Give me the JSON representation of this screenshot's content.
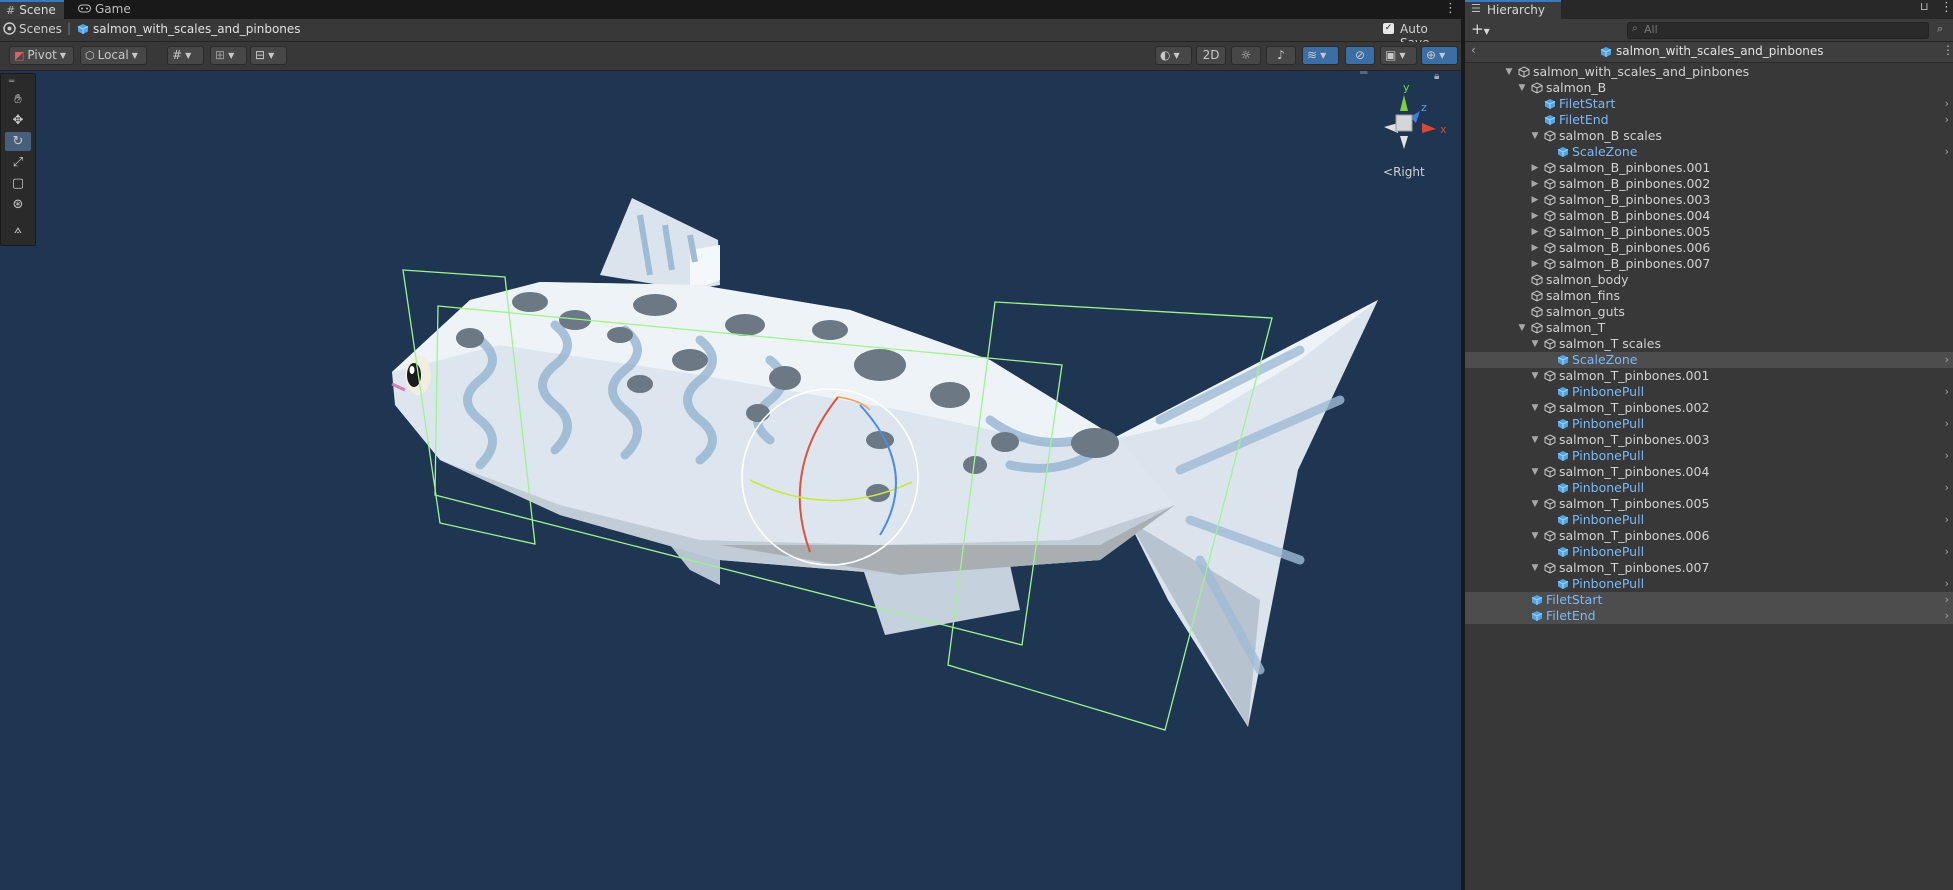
{
  "scene_tabs": [
    {
      "label": "Scene",
      "icon": "grid-icon",
      "active": true
    },
    {
      "label": "Game",
      "icon": "gamepad-icon",
      "active": false
    }
  ],
  "breadcrumb": {
    "root": "Scenes",
    "current": "salmon_with_scales_and_pinbones"
  },
  "auto_save": {
    "label": "Auto Save",
    "checked": true
  },
  "toolbar": {
    "pivot": "Pivot",
    "local": "Local",
    "mode_2d": "2D"
  },
  "gizmo": {
    "view_label": "Right",
    "axis_y": "y",
    "axis_z": "z",
    "axis_x": "x"
  },
  "tools": [
    "hand-tool",
    "move-tool",
    "rotate-tool",
    "scale-tool",
    "rect-tool",
    "transform-tool",
    "custom-tool"
  ],
  "hierarchy": {
    "tab_label": "Hierarchy",
    "search_placeholder": "All",
    "scene_name": "salmon_with_scales_and_pinbones",
    "rows": [
      {
        "label": "salmon_with_scales_and_pinbones",
        "depth": 0,
        "arrow": "open",
        "prefab": false,
        "chevron": false,
        "selected": false
      },
      {
        "label": "salmon_B",
        "depth": 1,
        "arrow": "open",
        "prefab": false,
        "chevron": false,
        "selected": false
      },
      {
        "label": "FiletStart",
        "depth": 2,
        "arrow": "none",
        "prefab": true,
        "chevron": true,
        "selected": false
      },
      {
        "label": "FiletEnd",
        "depth": 2,
        "arrow": "none",
        "prefab": true,
        "chevron": true,
        "selected": false
      },
      {
        "label": "salmon_B scales",
        "depth": 2,
        "arrow": "open",
        "prefab": false,
        "chevron": false,
        "selected": false
      },
      {
        "label": "ScaleZone",
        "depth": 3,
        "arrow": "none",
        "prefab": true,
        "chevron": true,
        "selected": false
      },
      {
        "label": "salmon_B_pinbones.001",
        "depth": 2,
        "arrow": "closed",
        "prefab": false,
        "chevron": false,
        "selected": false
      },
      {
        "label": "salmon_B_pinbones.002",
        "depth": 2,
        "arrow": "closed",
        "prefab": false,
        "chevron": false,
        "selected": false
      },
      {
        "label": "salmon_B_pinbones.003",
        "depth": 2,
        "arrow": "closed",
        "prefab": false,
        "chevron": false,
        "selected": false
      },
      {
        "label": "salmon_B_pinbones.004",
        "depth": 2,
        "arrow": "closed",
        "prefab": false,
        "chevron": false,
        "selected": false
      },
      {
        "label": "salmon_B_pinbones.005",
        "depth": 2,
        "arrow": "closed",
        "prefab": false,
        "chevron": false,
        "selected": false
      },
      {
        "label": "salmon_B_pinbones.006",
        "depth": 2,
        "arrow": "closed",
        "prefab": false,
        "chevron": false,
        "selected": false
      },
      {
        "label": "salmon_B_pinbones.007",
        "depth": 2,
        "arrow": "closed",
        "prefab": false,
        "chevron": false,
        "selected": false
      },
      {
        "label": "salmon_body",
        "depth": 1,
        "arrow": "none",
        "prefab": false,
        "chevron": false,
        "selected": false
      },
      {
        "label": "salmon_fins",
        "depth": 1,
        "arrow": "none",
        "prefab": false,
        "chevron": false,
        "selected": false
      },
      {
        "label": "salmon_guts",
        "depth": 1,
        "arrow": "none",
        "prefab": false,
        "chevron": false,
        "selected": false
      },
      {
        "label": "salmon_T",
        "depth": 1,
        "arrow": "open",
        "prefab": false,
        "chevron": false,
        "selected": false
      },
      {
        "label": "salmon_T scales",
        "depth": 2,
        "arrow": "open",
        "prefab": false,
        "chevron": false,
        "selected": false
      },
      {
        "label": "ScaleZone",
        "depth": 3,
        "arrow": "none",
        "prefab": true,
        "chevron": true,
        "selected": true
      },
      {
        "label": "salmon_T_pinbones.001",
        "depth": 2,
        "arrow": "open",
        "prefab": false,
        "chevron": false,
        "selected": false
      },
      {
        "label": "PinbonePull",
        "depth": 3,
        "arrow": "none",
        "prefab": true,
        "chevron": true,
        "selected": false
      },
      {
        "label": "salmon_T_pinbones.002",
        "depth": 2,
        "arrow": "open",
        "prefab": false,
        "chevron": false,
        "selected": false
      },
      {
        "label": "PinbonePull",
        "depth": 3,
        "arrow": "none",
        "prefab": true,
        "chevron": true,
        "selected": false
      },
      {
        "label": "salmon_T_pinbones.003",
        "depth": 2,
        "arrow": "open",
        "prefab": false,
        "chevron": false,
        "selected": false
      },
      {
        "label": "PinbonePull",
        "depth": 3,
        "arrow": "none",
        "prefab": true,
        "chevron": true,
        "selected": false
      },
      {
        "label": "salmon_T_pinbones.004",
        "depth": 2,
        "arrow": "open",
        "prefab": false,
        "chevron": false,
        "selected": false
      },
      {
        "label": "PinbonePull",
        "depth": 3,
        "arrow": "none",
        "prefab": true,
        "chevron": true,
        "selected": false
      },
      {
        "label": "salmon_T_pinbones.005",
        "depth": 2,
        "arrow": "open",
        "prefab": false,
        "chevron": false,
        "selected": false
      },
      {
        "label": "PinbonePull",
        "depth": 3,
        "arrow": "none",
        "prefab": true,
        "chevron": true,
        "selected": false
      },
      {
        "label": "salmon_T_pinbones.006",
        "depth": 2,
        "arrow": "open",
        "prefab": false,
        "chevron": false,
        "selected": false
      },
      {
        "label": "PinbonePull",
        "depth": 3,
        "arrow": "none",
        "prefab": true,
        "chevron": true,
        "selected": false
      },
      {
        "label": "salmon_T_pinbones.007",
        "depth": 2,
        "arrow": "open",
        "prefab": false,
        "chevron": false,
        "selected": false
      },
      {
        "label": "PinbonePull",
        "depth": 3,
        "arrow": "none",
        "prefab": true,
        "chevron": true,
        "selected": false
      },
      {
        "label": "FiletStart",
        "depth": 1,
        "arrow": "none",
        "prefab": true,
        "chevron": true,
        "selected": true
      },
      {
        "label": "FiletEnd",
        "depth": 1,
        "arrow": "none",
        "prefab": true,
        "chevron": true,
        "selected": true
      }
    ]
  },
  "colors": {
    "viewport_bg": "#1f3653",
    "prefab_text": "#7cb9f4",
    "selection_row": "#4d4d4d",
    "bounds_green": "#9cf58c",
    "accent_blue": "#3a6ea5"
  }
}
